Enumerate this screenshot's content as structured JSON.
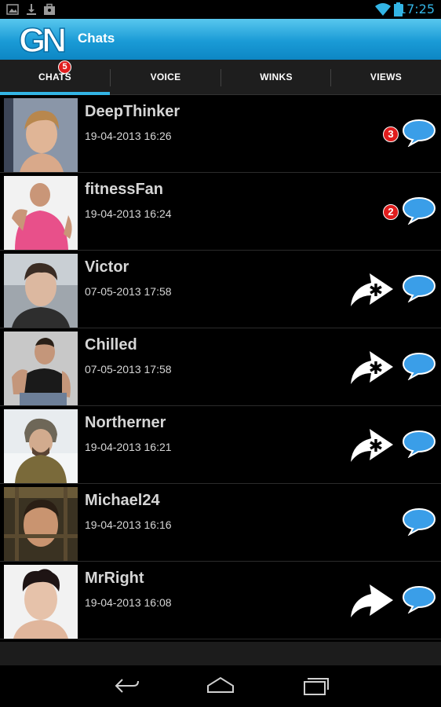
{
  "status_bar": {
    "time": "17:25",
    "left_icons": [
      "gallery-icon",
      "download-icon",
      "briefcase-icon"
    ],
    "right_icons": [
      "wifi-icon",
      "battery-icon"
    ]
  },
  "action_bar": {
    "logo_text": "GN",
    "title": "Chats"
  },
  "tabs": [
    {
      "label": "CHATS",
      "selected": true,
      "badge": "5"
    },
    {
      "label": "VOICE",
      "selected": false
    },
    {
      "label": "WINKS",
      "selected": false
    },
    {
      "label": "VIEWS",
      "selected": false
    }
  ],
  "colors": {
    "accent": "#33b5e5",
    "badge": "#e01d1d",
    "bubble": "#3a9ee8"
  },
  "chats": [
    {
      "name": "DeepThinker",
      "date": "19-04-2013 16:26",
      "unread": "3",
      "wink": "none"
    },
    {
      "name": "fitnessFan",
      "date": "19-04-2013 16:24",
      "unread": "2",
      "wink": "none"
    },
    {
      "name": "Victor",
      "date": "07-05-2013 17:58",
      "unread": "",
      "wink": "wink-star"
    },
    {
      "name": "Chilled",
      "date": "07-05-2013 17:58",
      "unread": "",
      "wink": "wink-star"
    },
    {
      "name": "Northerner",
      "date": "19-04-2013 16:21",
      "unread": "",
      "wink": "wink-star"
    },
    {
      "name": "Michael24",
      "date": "19-04-2013 16:16",
      "unread": "",
      "wink": "none"
    },
    {
      "name": "MrRight",
      "date": "19-04-2013 16:08",
      "unread": "",
      "wink": "wink-plain"
    }
  ],
  "nav_bar": [
    "back-icon",
    "home-icon",
    "recent-apps-icon"
  ]
}
